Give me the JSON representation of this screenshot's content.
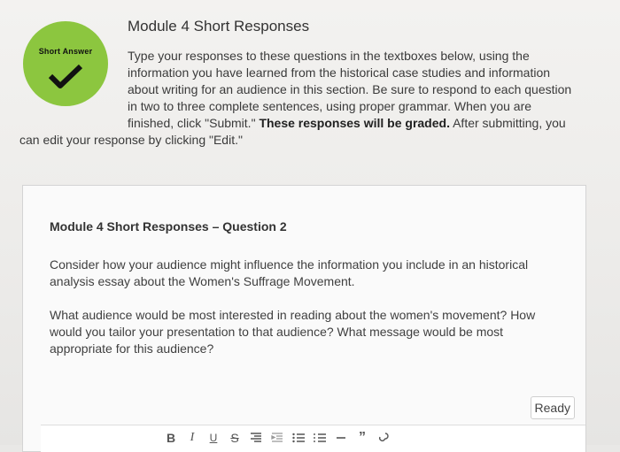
{
  "module": {
    "title": "Module 4 Short Responses"
  },
  "badge": {
    "label": "Short Answer",
    "icon": "checkmark-icon",
    "color": "#8cc63f"
  },
  "intro": {
    "lines": [
      "Type your responses to these questions in the textboxes below, using the",
      "information you have learned from the historical case studies and information",
      "about writing for an audience in this section. Be sure to respond to each question",
      "in two to three complete sentences, using proper grammar. When you are"
    ],
    "line5_pre": "finished, click \"Submit.\" ",
    "line5_bold": "These responses will be graded.",
    "line5_post": " After submitting, you",
    "line6": "can edit your response by clicking \"Edit.\""
  },
  "question": {
    "title": "Module 4 Short Responses – Question 2",
    "para1": [
      "Consider how your audience might influence the information you include in an historical",
      "analysis essay about the Women's Suffrage Movement."
    ],
    "para2": [
      "What audience would be most interested in reading about the women's movement? How",
      "would you tailor your presentation to that audience? What message would be most",
      "appropriate for this audience?"
    ]
  },
  "status_button": "Ready",
  "toolbar": {
    "bold": "B",
    "italic": "I",
    "underline": "U",
    "strike": "S",
    "icons": [
      "align-right-icon",
      "indent-icon",
      "bullet-list-icon",
      "numbered-list-icon",
      "horizontal-rule-icon",
      "quote-icon",
      "link-icon"
    ],
    "quote": "”"
  }
}
